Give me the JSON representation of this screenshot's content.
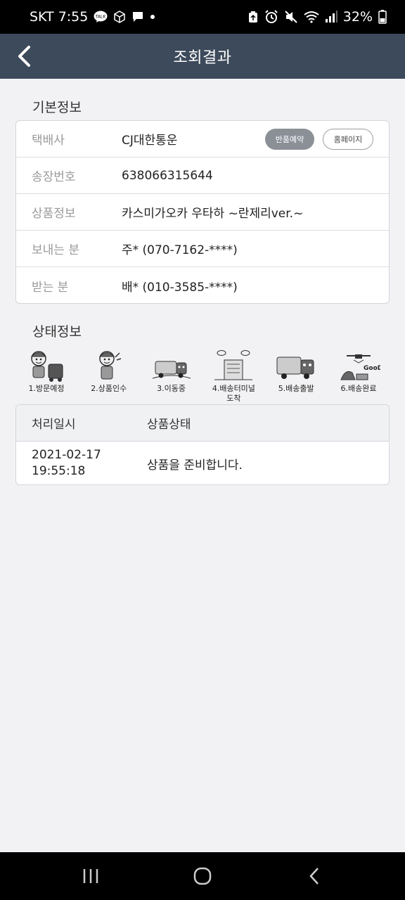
{
  "status_bar": {
    "carrier_time": "SKT 7:55",
    "battery": "32%",
    "icons_left": [
      "talk-icon",
      "box-icon",
      "chat-icon",
      "dot-icon"
    ],
    "icons_right": [
      "recycle-icon",
      "alarm-icon",
      "mute-icon",
      "wifi-icon",
      "signal-icon",
      "battery-icon"
    ]
  },
  "appbar": {
    "title": "조회결과"
  },
  "basic": {
    "title": "기본정보",
    "rows": [
      {
        "label": "택배사",
        "value": "CJ대한통운"
      },
      {
        "label": "송장번호",
        "value": "638066315644"
      },
      {
        "label": "상품정보",
        "value": "카스미가오카 우타하 ~란제리ver.~"
      },
      {
        "label": "보내는 분",
        "value": "주* (070-7162-****)"
      },
      {
        "label": "받는 분",
        "value": "배* (010-3585-****)"
      }
    ],
    "return_button": "반품예약",
    "homepage_button": "홈페이지"
  },
  "status": {
    "title": "상태정보",
    "steps": [
      {
        "label": "1.방문예정",
        "icon": "courier-visit-icon",
        "active": false
      },
      {
        "label": "2.상품인수",
        "icon": "courier-pickup-icon",
        "active": false
      },
      {
        "label": "3.이동중",
        "icon": "truck-moving-icon",
        "active": false
      },
      {
        "label": "4.배송터미널 도착",
        "label_line1": "4.배송터미널",
        "label_line2": "도착",
        "icon": "terminal-building-icon",
        "active": false
      },
      {
        "label": "5.배송출발",
        "icon": "truck-departure-icon",
        "active": false
      },
      {
        "label": "6.배송완료",
        "icon": "delivery-complete-icon",
        "active": false
      }
    ],
    "table": {
      "headers": [
        "처리일시",
        "상품상태"
      ],
      "rows": [
        {
          "date": "2021-02-17",
          "time": "19:55:18",
          "state": "상품을 준비합니다."
        }
      ]
    }
  },
  "navbar": {
    "buttons": [
      "recent-apps-icon",
      "home-icon",
      "back-icon"
    ]
  }
}
